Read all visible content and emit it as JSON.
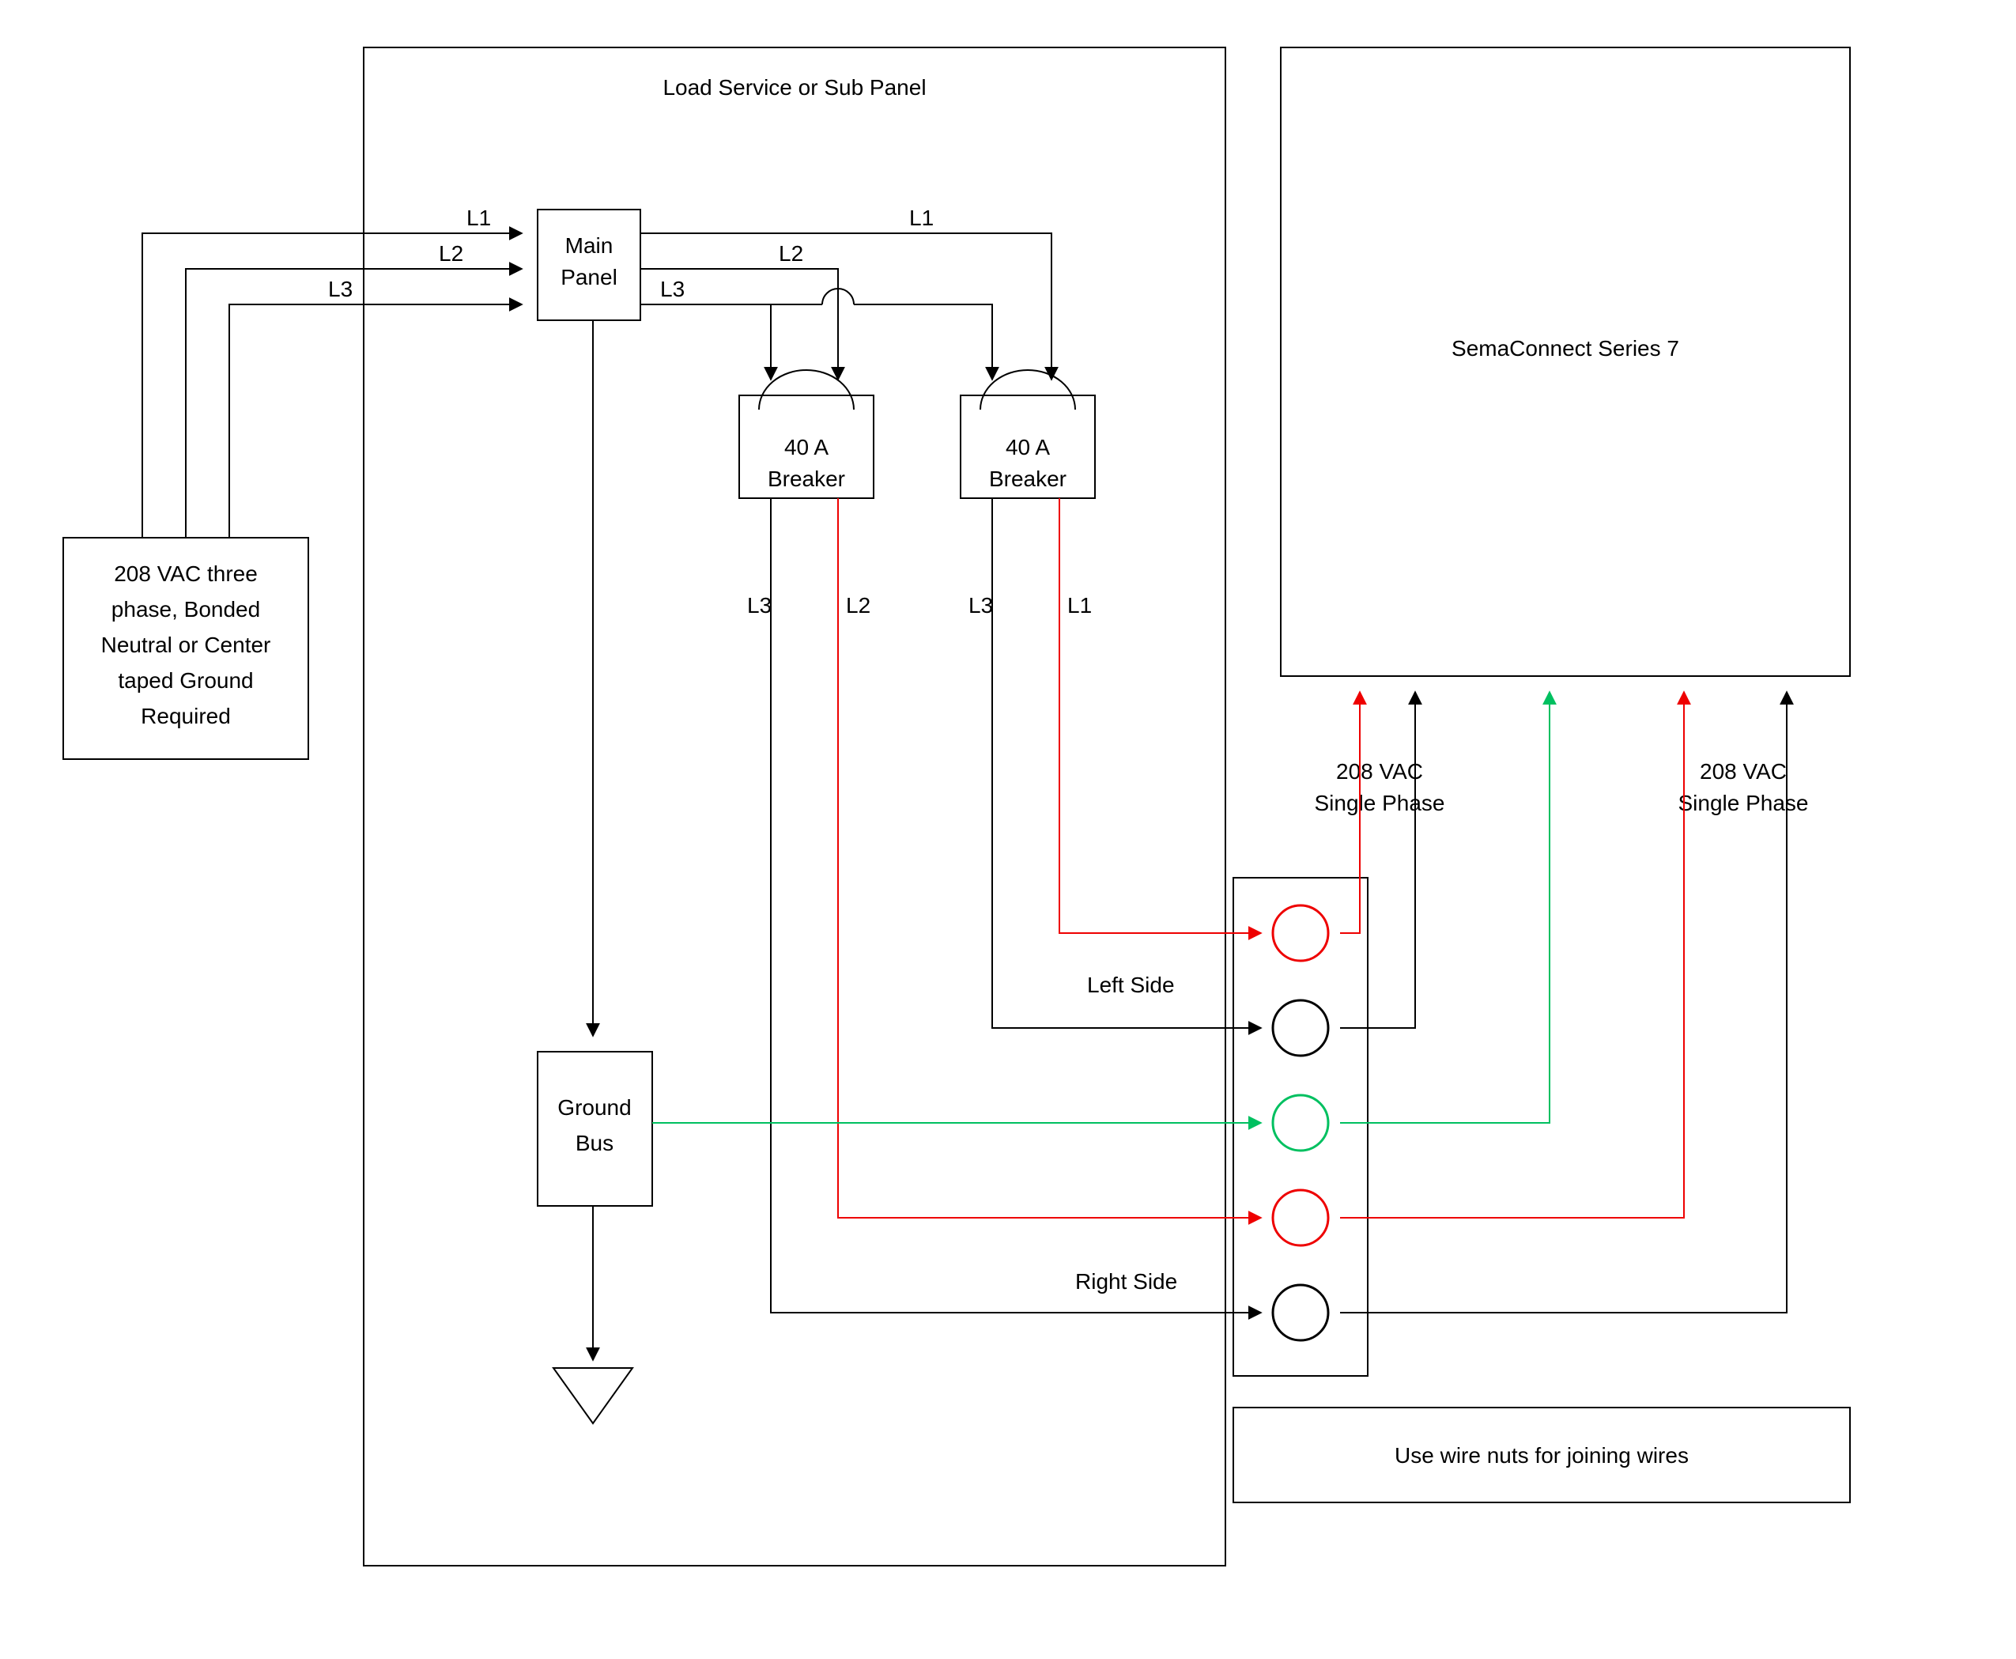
{
  "panel": {
    "title": "Load Service or Sub Panel"
  },
  "source": {
    "line1": "208 VAC three",
    "line2": "phase, Bonded",
    "line3": "Neutral or Center",
    "line4": "taped Ground",
    "line5": "Required"
  },
  "mainPanel": {
    "line1": "Main",
    "line2": "Panel"
  },
  "breaker1": {
    "line1": "40 A",
    "line2": "Breaker"
  },
  "breaker2": {
    "line1": "40 A",
    "line2": "Breaker"
  },
  "groundBus": {
    "line1": "Ground",
    "line2": "Bus"
  },
  "sema": {
    "title": "SemaConnect Series 7"
  },
  "phaseLabels": {
    "l1": "L1",
    "l2": "L2",
    "l3": "L3"
  },
  "vac1": {
    "line1": "208 VAC",
    "line2": "Single Phase"
  },
  "vac2": {
    "line1": "208 VAC",
    "line2": "Single Phase"
  },
  "sides": {
    "left": "Left Side",
    "right": "Right Side"
  },
  "note": "Use wire nuts for joining wires"
}
